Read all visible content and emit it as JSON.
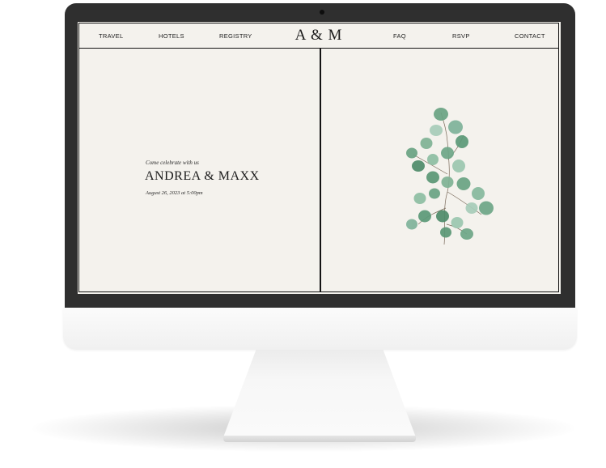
{
  "nav": {
    "left_links": [
      "TRAVEL",
      "HOTELS",
      "REGISTRY"
    ],
    "monogram": "A & M",
    "right_links": [
      "FAQ",
      "RSVP",
      "CONTACT"
    ]
  },
  "hero": {
    "tagline": "Come celebrate with us",
    "couple": "ANDREA & MAXX",
    "date": "August 26, 2023 at 5:00pm",
    "illustration": "eucalyptus-branch"
  },
  "colors": {
    "screen_bg": "#f4f2ed",
    "bezel": "#2f2f2f",
    "ink": "#141414",
    "leaf": "#5b9a76"
  }
}
